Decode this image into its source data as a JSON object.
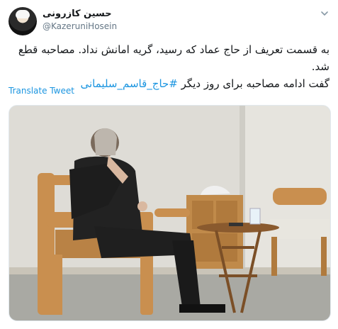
{
  "tweet": {
    "author_name": "حسین کازرونی",
    "author_handle": "@KazeruniHosein",
    "text_line1": "به قسمت تعریف از حاج عماد که رسید، گریه امانش نداد. مصاحبه قطع شد.",
    "text_line2_plain": "گفت ادامه مصاحبه برای روز دیگر ",
    "hashtag": "#حاج_قاسم_سلیمانی",
    "translate_label": "Translate Tweet"
  },
  "icons": {
    "menu": "chevron-down-icon",
    "avatar": "avatar"
  },
  "colors": {
    "link": "#1b95e0",
    "secondary_text": "#657786"
  }
}
